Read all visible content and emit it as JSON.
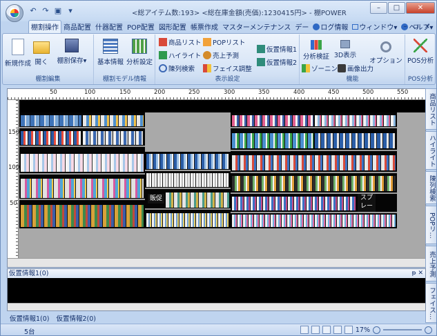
{
  "window": {
    "title": "<総アイテム数:193> <総在庫金額(売価):1230415円> - 棚POWER",
    "controls": {
      "minimize": "–",
      "maximize": "□",
      "close": "✕"
    }
  },
  "qat": {
    "undo": "↶",
    "redo": "↷",
    "save": "▣",
    "more": "▾"
  },
  "tabs": [
    "棚割操作",
    "商品配置",
    "什器配置",
    "POP配置",
    "図形配置",
    "帳票作成",
    "マスターメンテナンス",
    "デー",
    "ログ情報",
    "ウィンドウ",
    "ヘルプ"
  ],
  "tab_right": "– ▫ ×",
  "ribbon": {
    "groups": {
      "edit": {
        "label": "棚割編集",
        "new": "新規作成",
        "open": "開く",
        "save": "棚割保存"
      },
      "model": {
        "label": "棚割モデル情報",
        "basic": "基本情報",
        "analysis": "分析設定"
      },
      "display": {
        "label": "表示設定",
        "product_list": "商品リスト",
        "pop_list": "POPリスト",
        "highlight": "ハイライト",
        "sales": "売上予測",
        "display_search": "陳列検索",
        "face_adjust": "フェイス調整",
        "virtual1": "仮置情報1",
        "virtual2": "仮置情報2"
      },
      "function": {
        "label": "機能",
        "analysis_verify": "分析検証",
        "view3d": "3D表示",
        "zoning": "ゾーニング",
        "image_output": "画像出力",
        "option": "オプション"
      },
      "pos": {
        "label": "POS分析",
        "pos_analysis": "POS分析"
      }
    }
  },
  "ruler": {
    "h_labels": [
      "50",
      "100",
      "150",
      "200",
      "250",
      "300",
      "350",
      "400",
      "450",
      "500",
      "550"
    ],
    "v_labels": [
      "150",
      "100",
      "50"
    ]
  },
  "planogram": {
    "tags": {
      "left_tag": "販促",
      "right_tag_1": "スプ",
      "right_tag_2": "レー"
    }
  },
  "side_tabs": [
    "商品リスト",
    "ハイライト",
    "陳列検索",
    "POPリ…",
    "売上予測",
    "フェイス…"
  ],
  "panel": {
    "title": "仮置情報1(0)",
    "pin": "ᵽ ✕",
    "tabs": [
      "仮置情報1(0)",
      "仮置情報2(0)"
    ]
  },
  "status": {
    "left": "5台",
    "zoom": "17%"
  }
}
